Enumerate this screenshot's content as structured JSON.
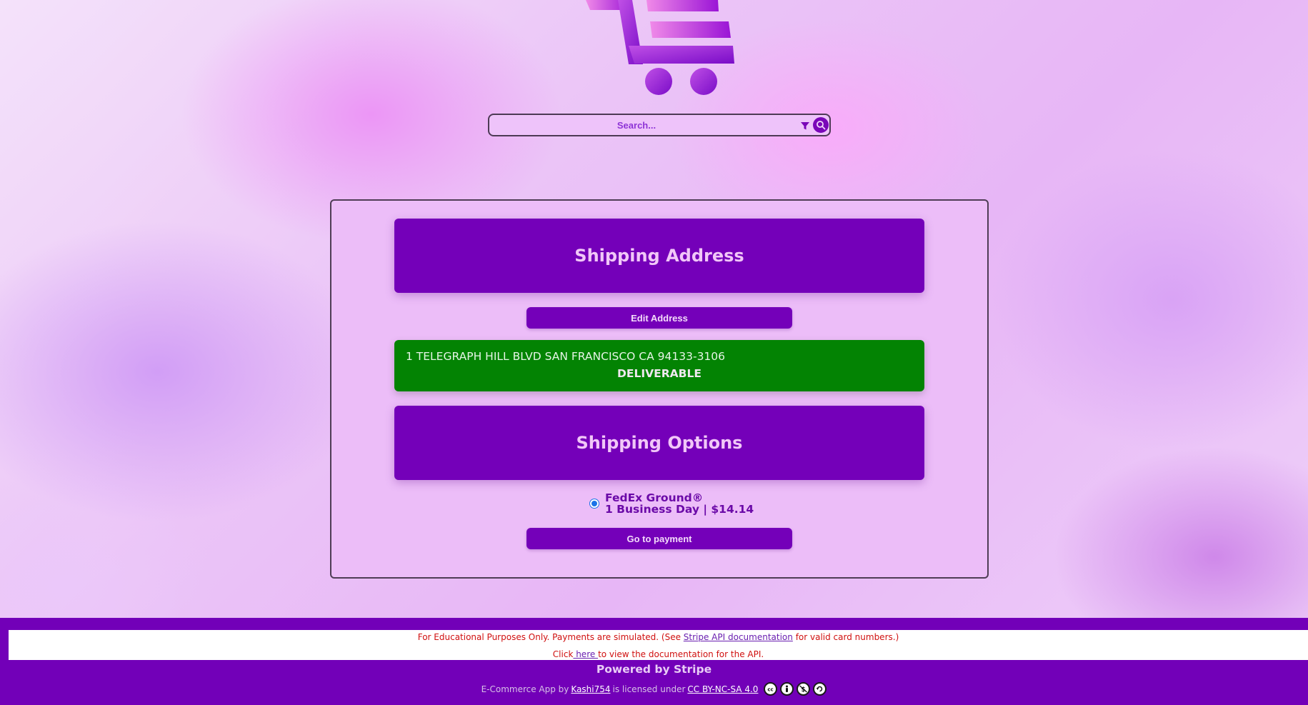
{
  "search": {
    "placeholder": "Search..."
  },
  "shipping_address": {
    "title": "Shipping Address",
    "edit_button": "Edit Address",
    "address_line": "1 TELEGRAPH HILL BLVD SAN FRANCISCO CA 94133-3106",
    "status": "DELIVERABLE"
  },
  "shipping_options": {
    "title": "Shipping Options",
    "options": [
      {
        "carrier": "FedEx Ground®",
        "detail": "1 Business Day | $14.14",
        "selected": true
      }
    ],
    "pay_button": "Go to payment"
  },
  "footer": {
    "notice_prefix": "For Educational Purposes Only. Payments are simulated. (See ",
    "notice_link": "Stripe API documentation",
    "notice_suffix": " for valid card numbers.)",
    "click_prefix": "Click",
    "click_link": " here ",
    "click_suffix": "to view the documentation for the API.",
    "powered_by": "Powered by Stripe",
    "license_prefix": "E-Commerce App by",
    "author_link": " Kashi754",
    "license_mid": " is licensed under ",
    "license_link": "CC BY-NC-SA 4.0 "
  },
  "colors": {
    "primary": "#7400b9",
    "deliverable": "#038303",
    "card_bg": "#ecbdf8",
    "notice_text": "#d01010"
  },
  "icons": {
    "logo": "shopping-cart-logo",
    "filter": "filter-icon",
    "search": "search-icon",
    "license": [
      "cc-icon",
      "by-icon",
      "nc-icon",
      "sa-icon"
    ]
  }
}
